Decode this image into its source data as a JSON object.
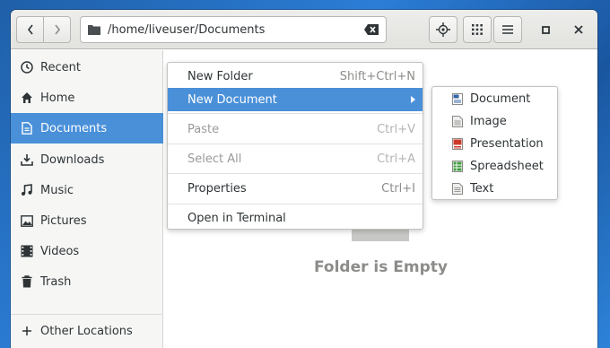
{
  "path": {
    "text": "/home/liveuser/Documents"
  },
  "sidebar": {
    "items": [
      {
        "label": "Recent",
        "icon": "clock-icon"
      },
      {
        "label": "Home",
        "icon": "home-icon"
      },
      {
        "label": "Documents",
        "icon": "document-icon"
      },
      {
        "label": "Downloads",
        "icon": "download-icon"
      },
      {
        "label": "Music",
        "icon": "music-icon"
      },
      {
        "label": "Pictures",
        "icon": "picture-icon"
      },
      {
        "label": "Videos",
        "icon": "film-icon"
      },
      {
        "label": "Trash",
        "icon": "trash-icon"
      }
    ],
    "other": {
      "label": "Other Locations",
      "icon": "plus-icon"
    }
  },
  "main": {
    "empty_text": "Folder is Empty"
  },
  "context_menu": {
    "items": [
      {
        "label": "New Folder",
        "accel": "Shift+Ctrl+N"
      },
      {
        "label": "New Document",
        "accel": ""
      },
      {
        "label": "Paste",
        "accel": "Ctrl+V"
      },
      {
        "label": "Select All",
        "accel": "Ctrl+A"
      },
      {
        "label": "Properties",
        "accel": "Ctrl+I"
      },
      {
        "label": "Open in Terminal",
        "accel": ""
      }
    ]
  },
  "submenu": {
    "items": [
      {
        "label": "Document",
        "icon": "writer-document-icon"
      },
      {
        "label": "Image",
        "icon": "image-file-icon"
      },
      {
        "label": "Presentation",
        "icon": "presentation-file-icon"
      },
      {
        "label": "Spreadsheet",
        "icon": "spreadsheet-file-icon"
      },
      {
        "label": "Text",
        "icon": "text-file-icon"
      }
    ]
  },
  "colors": {
    "accent": "#4a90d9",
    "empty_text": "#8c8c8a"
  }
}
